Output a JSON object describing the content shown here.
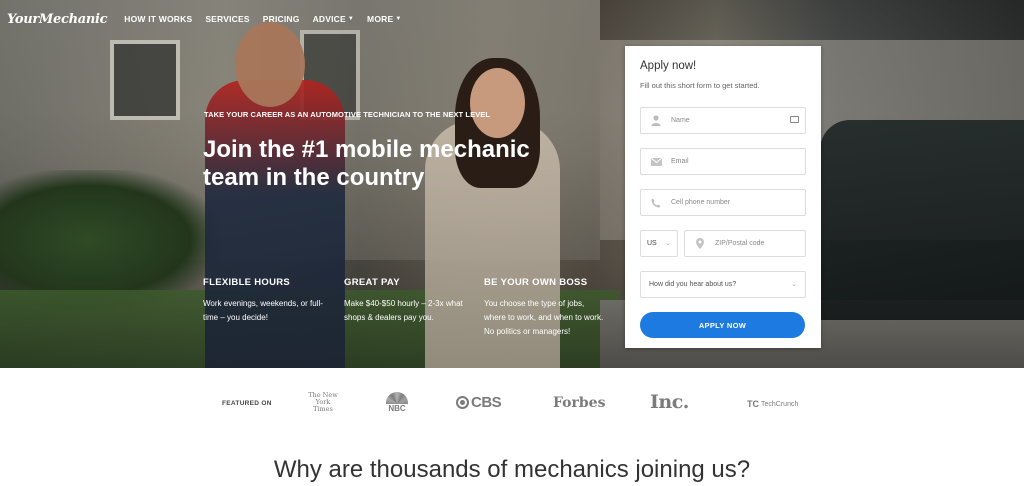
{
  "nav": {
    "logo": "YourMechanic",
    "items": [
      {
        "label": "HOW IT WORKS",
        "dropdown": false
      },
      {
        "label": "SERVICES",
        "dropdown": false
      },
      {
        "label": "PRICING",
        "dropdown": false
      },
      {
        "label": "ADVICE",
        "dropdown": true
      },
      {
        "label": "MORE",
        "dropdown": true
      }
    ]
  },
  "hero": {
    "eyebrow": "TAKE YOUR CAREER AS AN AUTOMOTIVE TECHNICIAN TO THE NEXT LEVEL",
    "headline": "Join the #1 mobile mechanic team in the country",
    "features": [
      {
        "title": "FLEXIBLE HOURS",
        "desc": "Work evenings, weekends, or full-time – you decide!"
      },
      {
        "title": "GREAT PAY",
        "desc": "Make $40-$50 hourly – 2-3x what shops & dealers pay you."
      },
      {
        "title": "BE YOUR OWN BOSS",
        "desc": "You choose the type of jobs, where to work, and when to work. No politics or managers!"
      }
    ]
  },
  "form": {
    "title": "Apply now!",
    "subtitle": "Fill out this short form to get started.",
    "name_placeholder": "Name",
    "email_placeholder": "Email",
    "phone_placeholder": "Cell phone number",
    "country_value": "US",
    "zip_placeholder": "ZIP/Postal code",
    "referral_placeholder": "How did you hear about us?",
    "submit_label": "APPLY NOW",
    "accent_color": "#1d7ae0"
  },
  "featured": {
    "label": "FEATURED ON",
    "outlets": {
      "nyt": "The New York Times",
      "nbc": "NBC",
      "cbs": "CBS",
      "forbes": "Forbes",
      "inc": "Inc.",
      "techcrunch": "TechCrunch"
    }
  },
  "section": {
    "title": "Why are thousands of mechanics joining us?"
  }
}
